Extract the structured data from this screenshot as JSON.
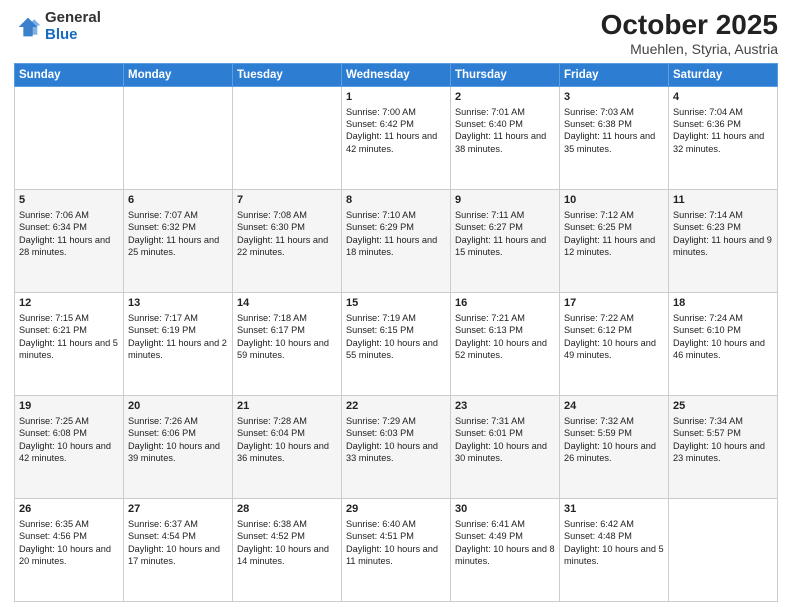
{
  "logo": {
    "general": "General",
    "blue": "Blue"
  },
  "header": {
    "title": "October 2025",
    "subtitle": "Muehlen, Styria, Austria"
  },
  "weekdays": [
    "Sunday",
    "Monday",
    "Tuesday",
    "Wednesday",
    "Thursday",
    "Friday",
    "Saturday"
  ],
  "weeks": [
    [
      {
        "day": "",
        "sunrise": "",
        "sunset": "",
        "daylight": ""
      },
      {
        "day": "",
        "sunrise": "",
        "sunset": "",
        "daylight": ""
      },
      {
        "day": "",
        "sunrise": "",
        "sunset": "",
        "daylight": ""
      },
      {
        "day": "1",
        "sunrise": "Sunrise: 7:00 AM",
        "sunset": "Sunset: 6:42 PM",
        "daylight": "Daylight: 11 hours and 42 minutes."
      },
      {
        "day": "2",
        "sunrise": "Sunrise: 7:01 AM",
        "sunset": "Sunset: 6:40 PM",
        "daylight": "Daylight: 11 hours and 38 minutes."
      },
      {
        "day": "3",
        "sunrise": "Sunrise: 7:03 AM",
        "sunset": "Sunset: 6:38 PM",
        "daylight": "Daylight: 11 hours and 35 minutes."
      },
      {
        "day": "4",
        "sunrise": "Sunrise: 7:04 AM",
        "sunset": "Sunset: 6:36 PM",
        "daylight": "Daylight: 11 hours and 32 minutes."
      }
    ],
    [
      {
        "day": "5",
        "sunrise": "Sunrise: 7:06 AM",
        "sunset": "Sunset: 6:34 PM",
        "daylight": "Daylight: 11 hours and 28 minutes."
      },
      {
        "day": "6",
        "sunrise": "Sunrise: 7:07 AM",
        "sunset": "Sunset: 6:32 PM",
        "daylight": "Daylight: 11 hours and 25 minutes."
      },
      {
        "day": "7",
        "sunrise": "Sunrise: 7:08 AM",
        "sunset": "Sunset: 6:30 PM",
        "daylight": "Daylight: 11 hours and 22 minutes."
      },
      {
        "day": "8",
        "sunrise": "Sunrise: 7:10 AM",
        "sunset": "Sunset: 6:29 PM",
        "daylight": "Daylight: 11 hours and 18 minutes."
      },
      {
        "day": "9",
        "sunrise": "Sunrise: 7:11 AM",
        "sunset": "Sunset: 6:27 PM",
        "daylight": "Daylight: 11 hours and 15 minutes."
      },
      {
        "day": "10",
        "sunrise": "Sunrise: 7:12 AM",
        "sunset": "Sunset: 6:25 PM",
        "daylight": "Daylight: 11 hours and 12 minutes."
      },
      {
        "day": "11",
        "sunrise": "Sunrise: 7:14 AM",
        "sunset": "Sunset: 6:23 PM",
        "daylight": "Daylight: 11 hours and 9 minutes."
      }
    ],
    [
      {
        "day": "12",
        "sunrise": "Sunrise: 7:15 AM",
        "sunset": "Sunset: 6:21 PM",
        "daylight": "Daylight: 11 hours and 5 minutes."
      },
      {
        "day": "13",
        "sunrise": "Sunrise: 7:17 AM",
        "sunset": "Sunset: 6:19 PM",
        "daylight": "Daylight: 11 hours and 2 minutes."
      },
      {
        "day": "14",
        "sunrise": "Sunrise: 7:18 AM",
        "sunset": "Sunset: 6:17 PM",
        "daylight": "Daylight: 10 hours and 59 minutes."
      },
      {
        "day": "15",
        "sunrise": "Sunrise: 7:19 AM",
        "sunset": "Sunset: 6:15 PM",
        "daylight": "Daylight: 10 hours and 55 minutes."
      },
      {
        "day": "16",
        "sunrise": "Sunrise: 7:21 AM",
        "sunset": "Sunset: 6:13 PM",
        "daylight": "Daylight: 10 hours and 52 minutes."
      },
      {
        "day": "17",
        "sunrise": "Sunrise: 7:22 AM",
        "sunset": "Sunset: 6:12 PM",
        "daylight": "Daylight: 10 hours and 49 minutes."
      },
      {
        "day": "18",
        "sunrise": "Sunrise: 7:24 AM",
        "sunset": "Sunset: 6:10 PM",
        "daylight": "Daylight: 10 hours and 46 minutes."
      }
    ],
    [
      {
        "day": "19",
        "sunrise": "Sunrise: 7:25 AM",
        "sunset": "Sunset: 6:08 PM",
        "daylight": "Daylight: 10 hours and 42 minutes."
      },
      {
        "day": "20",
        "sunrise": "Sunrise: 7:26 AM",
        "sunset": "Sunset: 6:06 PM",
        "daylight": "Daylight: 10 hours and 39 minutes."
      },
      {
        "day": "21",
        "sunrise": "Sunrise: 7:28 AM",
        "sunset": "Sunset: 6:04 PM",
        "daylight": "Daylight: 10 hours and 36 minutes."
      },
      {
        "day": "22",
        "sunrise": "Sunrise: 7:29 AM",
        "sunset": "Sunset: 6:03 PM",
        "daylight": "Daylight: 10 hours and 33 minutes."
      },
      {
        "day": "23",
        "sunrise": "Sunrise: 7:31 AM",
        "sunset": "Sunset: 6:01 PM",
        "daylight": "Daylight: 10 hours and 30 minutes."
      },
      {
        "day": "24",
        "sunrise": "Sunrise: 7:32 AM",
        "sunset": "Sunset: 5:59 PM",
        "daylight": "Daylight: 10 hours and 26 minutes."
      },
      {
        "day": "25",
        "sunrise": "Sunrise: 7:34 AM",
        "sunset": "Sunset: 5:57 PM",
        "daylight": "Daylight: 10 hours and 23 minutes."
      }
    ],
    [
      {
        "day": "26",
        "sunrise": "Sunrise: 6:35 AM",
        "sunset": "Sunset: 4:56 PM",
        "daylight": "Daylight: 10 hours and 20 minutes."
      },
      {
        "day": "27",
        "sunrise": "Sunrise: 6:37 AM",
        "sunset": "Sunset: 4:54 PM",
        "daylight": "Daylight: 10 hours and 17 minutes."
      },
      {
        "day": "28",
        "sunrise": "Sunrise: 6:38 AM",
        "sunset": "Sunset: 4:52 PM",
        "daylight": "Daylight: 10 hours and 14 minutes."
      },
      {
        "day": "29",
        "sunrise": "Sunrise: 6:40 AM",
        "sunset": "Sunset: 4:51 PM",
        "daylight": "Daylight: 10 hours and 11 minutes."
      },
      {
        "day": "30",
        "sunrise": "Sunrise: 6:41 AM",
        "sunset": "Sunset: 4:49 PM",
        "daylight": "Daylight: 10 hours and 8 minutes."
      },
      {
        "day": "31",
        "sunrise": "Sunrise: 6:42 AM",
        "sunset": "Sunset: 4:48 PM",
        "daylight": "Daylight: 10 hours and 5 minutes."
      },
      {
        "day": "",
        "sunrise": "",
        "sunset": "",
        "daylight": ""
      }
    ]
  ]
}
